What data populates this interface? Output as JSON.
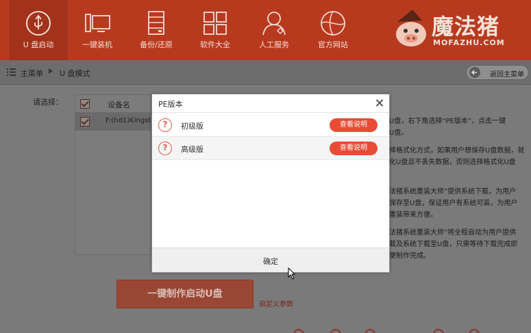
{
  "nav": [
    {
      "label": "U 盘启动",
      "icon": "usb-icon"
    },
    {
      "label": "一键装机",
      "icon": "monitor-icon"
    },
    {
      "label": "备份/还原",
      "icon": "server-icon"
    },
    {
      "label": "软件大全",
      "icon": "grid-icon"
    },
    {
      "label": "人工服务",
      "icon": "person-icon"
    },
    {
      "label": "官方网站",
      "icon": "globe-icon"
    }
  ],
  "logo": {
    "title": "魔法猪",
    "subtitle": "MOFAZHU.COM"
  },
  "breadcrumb": {
    "home": "主菜单",
    "current": "U 盘模式",
    "back_label": "返回主菜单"
  },
  "content": {
    "select_label": "请选择：",
    "device_column": "设备名",
    "device_name": "F:(hd1)Kingston",
    "info_lines": [
      "U盘，右下角选择“PE版本”，点击一键",
      "U盘。",
      "择格式化方式，如果用户想保存U盘数据，就",
      "化U盘且不丢失数据，否则选择格式化U盘",
      "法猪系统重装大师”提供系统下载，为用户",
      "保存至U盘，保证用户有系统可装，为用户",
      "重装带来方便。",
      "法猪系统重装大师”将全程自动为用户提供",
      "载及系统下载至U盘，只需等待下载完成即",
      "便制作完成。"
    ],
    "make_button": "一键制作启动U盘",
    "custom_param": "自定义参数"
  },
  "modal": {
    "title": "PE版本",
    "options": [
      {
        "label": "初级版",
        "button": "查看说明"
      },
      {
        "label": "高级版",
        "button": "查看说明"
      }
    ],
    "confirm": "确定"
  },
  "colors": {
    "brand": "#b83a1e",
    "accent": "#e94b35"
  }
}
